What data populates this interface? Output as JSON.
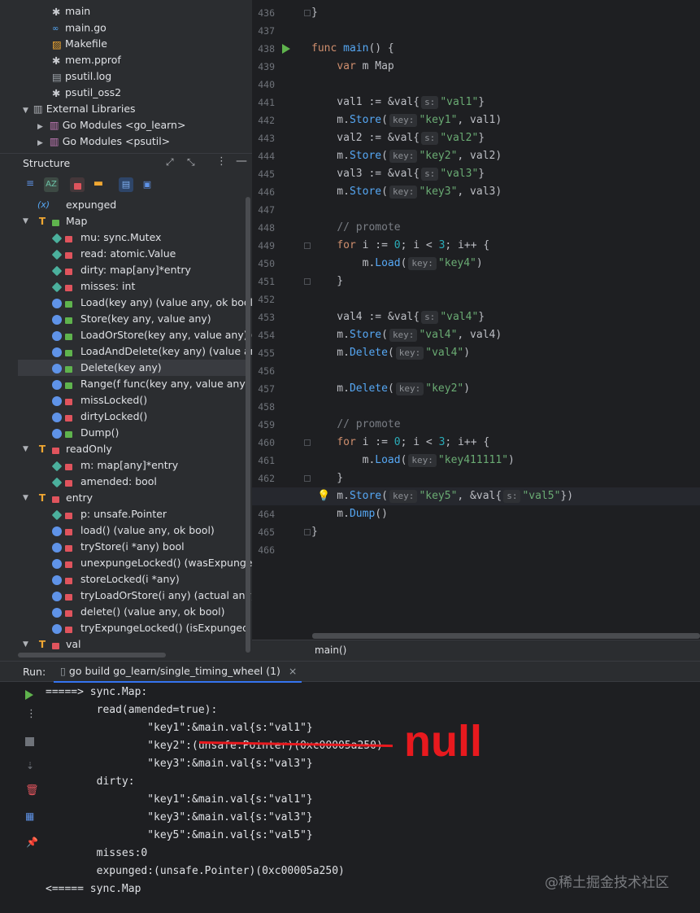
{
  "project": {
    "files": [
      {
        "name": "main",
        "icon": "asterisk-file-icon"
      },
      {
        "name": "main.go",
        "icon": "go-file-icon"
      },
      {
        "name": "Makefile",
        "icon": "makefile-icon"
      },
      {
        "name": "mem.pprof",
        "icon": "asterisk-file-icon"
      },
      {
        "name": "psutil.log",
        "icon": "text-file-icon"
      },
      {
        "name": "psutil_oss2",
        "icon": "asterisk-file-icon"
      }
    ],
    "external": "External Libraries",
    "modules": [
      "Go Modules <go_learn>",
      "Go Modules <psutil>"
    ]
  },
  "structure": {
    "title": "Structure",
    "items": [
      {
        "label": "expunged",
        "kind": "var",
        "indent": 0
      },
      {
        "label": "Map",
        "kind": "struct",
        "indent": 0,
        "open": true
      },
      {
        "label": "mu: sync.Mutex",
        "kind": "field",
        "indent": 1
      },
      {
        "label": "read: atomic.Value",
        "kind": "field",
        "indent": 1
      },
      {
        "label": "dirty: map[any]*entry",
        "kind": "field",
        "indent": 1
      },
      {
        "label": "misses: int",
        "kind": "field",
        "indent": 1
      },
      {
        "label": "Load(key any) (value any, ok bool)",
        "kind": "method-pub",
        "indent": 1
      },
      {
        "label": "Store(key any, value any)",
        "kind": "method-pub",
        "indent": 1
      },
      {
        "label": "LoadOrStore(key any, value any) (ac",
        "kind": "method-pub",
        "indent": 1
      },
      {
        "label": "LoadAndDelete(key any) (value any,",
        "kind": "method-pub",
        "indent": 1
      },
      {
        "label": "Delete(key any)",
        "kind": "method-pub",
        "indent": 1,
        "selected": true
      },
      {
        "label": "Range(f func(key any, value any) boo",
        "kind": "method-pub",
        "indent": 1
      },
      {
        "label": "missLocked()",
        "kind": "method",
        "indent": 1
      },
      {
        "label": "dirtyLocked()",
        "kind": "method",
        "indent": 1
      },
      {
        "label": "Dump()",
        "kind": "method-pub",
        "indent": 1
      },
      {
        "label": "readOnly",
        "kind": "struct-priv",
        "indent": 0,
        "open": true
      },
      {
        "label": "m: map[any]*entry",
        "kind": "field",
        "indent": 1
      },
      {
        "label": "amended: bool",
        "kind": "field",
        "indent": 1
      },
      {
        "label": "entry",
        "kind": "struct-priv",
        "indent": 0,
        "open": true
      },
      {
        "label": "p: unsafe.Pointer",
        "kind": "field",
        "indent": 1
      },
      {
        "label": "load() (value any, ok bool)",
        "kind": "method",
        "indent": 1
      },
      {
        "label": "tryStore(i *any) bool",
        "kind": "method",
        "indent": 1
      },
      {
        "label": "unexpungeLocked() (wasExpunged b",
        "kind": "method",
        "indent": 1
      },
      {
        "label": "storeLocked(i *any)",
        "kind": "method",
        "indent": 1
      },
      {
        "label": "tryLoadOrStore(i any) (actual any, lo",
        "kind": "method",
        "indent": 1
      },
      {
        "label": "delete() (value any, ok bool)",
        "kind": "method",
        "indent": 1
      },
      {
        "label": "tryExpungeLocked() (isExpunged bo",
        "kind": "method",
        "indent": 1
      },
      {
        "label": "val",
        "kind": "struct-priv",
        "indent": 0,
        "open": true
      }
    ]
  },
  "editor": {
    "lines": [
      {
        "n": "436",
        "html": "<span class='ty'>}</span>"
      },
      {
        "n": "437",
        "html": ""
      },
      {
        "n": "438",
        "html": "<span class='kw'>func</span> <span class='fn'>main</span>() {"
      },
      {
        "n": "439",
        "html": "    <span class='kw'>var</span> m Map"
      },
      {
        "n": "440",
        "html": ""
      },
      {
        "n": "441",
        "html": "    val1 := &amp;val{<span class='hint'>s:</span><span class='str'>\"val1\"</span>}"
      },
      {
        "n": "442",
        "html": "    m.<span class='fn'>Store</span>(<span class='hint'>key:</span><span class='str'>\"key1\"</span>, val1)"
      },
      {
        "n": "443",
        "html": "    val2 := &amp;val{<span class='hint'>s:</span><span class='str'>\"val2\"</span>}"
      },
      {
        "n": "444",
        "html": "    m.<span class='fn'>Store</span>(<span class='hint'>key:</span><span class='str'>\"key2\"</span>, val2)"
      },
      {
        "n": "445",
        "html": "    val3 := &amp;val{<span class='hint'>s:</span><span class='str'>\"val3\"</span>}"
      },
      {
        "n": "446",
        "html": "    m.<span class='fn'>Store</span>(<span class='hint'>key:</span><span class='str'>\"key3\"</span>, val3)"
      },
      {
        "n": "447",
        "html": ""
      },
      {
        "n": "448",
        "html": "    <span class='cm'>// promote</span>"
      },
      {
        "n": "449",
        "html": "    <span class='kw'>for</span> i := <span class='num'>0</span>; i &lt; <span class='num'>3</span>; i++ {"
      },
      {
        "n": "450",
        "html": "        m.<span class='fn'>Load</span>(<span class='hint'>key:</span><span class='str'>\"key4\"</span>)"
      },
      {
        "n": "451",
        "html": "    }"
      },
      {
        "n": "452",
        "html": ""
      },
      {
        "n": "453",
        "html": "    val4 := &amp;val{<span class='hint'>s:</span><span class='str'>\"val4\"</span>}"
      },
      {
        "n": "454",
        "html": "    m.<span class='fn'>Store</span>(<span class='hint'>key:</span><span class='str'>\"val4\"</span>, val4)"
      },
      {
        "n": "455",
        "html": "    m.<span class='fn'>Delete</span>(<span class='hint'>key:</span><span class='str'>\"val4\"</span>)"
      },
      {
        "n": "456",
        "html": ""
      },
      {
        "n": "457",
        "html": "    m.<span class='fn'>Delete</span>(<span class='hint'>key:</span><span class='str'>\"key2\"</span>)"
      },
      {
        "n": "458",
        "html": ""
      },
      {
        "n": "459",
        "html": "    <span class='cm'>// promote</span>"
      },
      {
        "n": "460",
        "html": "    <span class='kw'>for</span> i := <span class='num'>0</span>; i &lt; <span class='num'>3</span>; i++ {"
      },
      {
        "n": "461",
        "html": "        m.<span class='fn'>Load</span>(<span class='hint'>key:</span><span class='str'>\"key411111\"</span>)"
      },
      {
        "n": "462",
        "html": "    }"
      },
      {
        "n": "463",
        "html": "    m.<span class='fn'>Store</span>(<span class='hint'>key:</span><span class='str'>\"key5\"</span>, &amp;val{<span class='hint'>s:</span><span class='str'>\"val5\"</span>})"
      },
      {
        "n": "464",
        "html": "    m.<span class='fn'>Dump</span>()"
      },
      {
        "n": "465",
        "html": "}"
      },
      {
        "n": "466",
        "html": ""
      }
    ],
    "breadcrumb": "main()"
  },
  "run": {
    "label": "Run:",
    "tab": "go build go_learn/single_timing_wheel (1)",
    "close": "×",
    "output": [
      "=====> sync.Map:",
      "        read(amended=true):",
      "                \"key1\":&main.val{s:\"val1\"}",
      "                \"key2\":(unsafe.Pointer)(0xc00005a250)",
      "                \"key3\":&main.val{s:\"val3\"}",
      "        dirty:",
      "                \"key1\":&main.val{s:\"val1\"}",
      "                \"key3\":&main.val{s:\"val3\"}",
      "                \"key5\":&main.val{s:\"val5\"}",
      "        misses:0",
      "        expunged:(unsafe.Pointer)(0xc00005a250)",
      "<===== sync.Map"
    ],
    "annotation": "null",
    "watermark": "@稀土掘金技术社区"
  },
  "colors": {
    "annotation": "#e8191e",
    "accent": "#5fb34d"
  }
}
